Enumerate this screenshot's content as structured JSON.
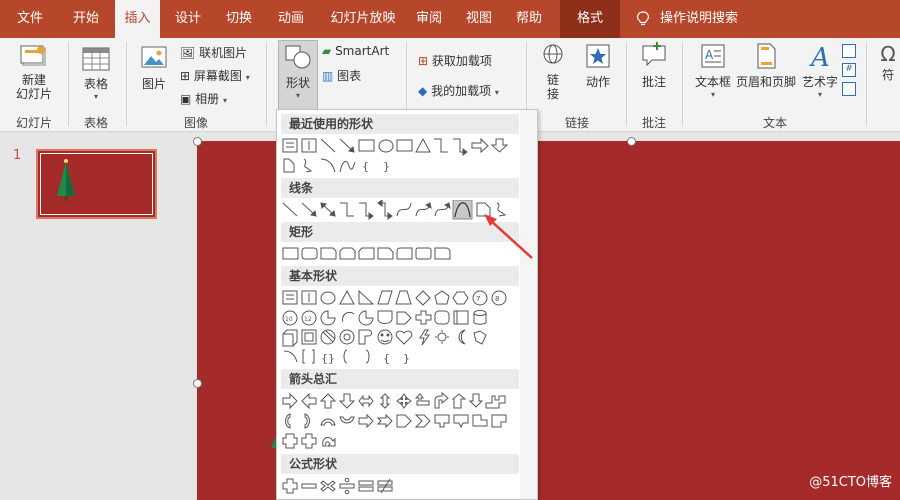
{
  "tabs": [
    "文件",
    "开始",
    "插入",
    "设计",
    "切换",
    "动画",
    "幻灯片放映",
    "审阅",
    "视图",
    "帮助",
    "格式"
  ],
  "active_tab": "插入",
  "tell_me": "操作说明搜索",
  "ribbon": {
    "new_slide": "新建\n幻灯片",
    "table": "表格",
    "images": "图片",
    "online_images": "联机图片",
    "screenshot": "屏幕截图",
    "album": "相册",
    "shapes": "形状",
    "smartart": "SmartArt",
    "chart": "图表",
    "get_addins": "获取加载项",
    "my_addins": "我的加载项",
    "link": "链\n接",
    "action": "动作",
    "comment": "批注",
    "textbox": "文本框",
    "header_footer": "页眉和页脚",
    "wordart": "艺术字",
    "symbol": "符",
    "groups": {
      "slides": "幻灯片",
      "tables": "表格",
      "images": "图像",
      "links": "链接",
      "comments": "批注",
      "text": "文本"
    }
  },
  "slide_panel": {
    "slide_number": "1"
  },
  "dropdown": {
    "sections": [
      "最近使用的形状",
      "线条",
      "矩形",
      "基本形状",
      "箭头总汇",
      "公式形状"
    ]
  },
  "watermark": "@51CTO博客",
  "colors": {
    "accent": "#b7472a",
    "slide_bg": "#a52a2a",
    "annotation": "#e53935"
  }
}
